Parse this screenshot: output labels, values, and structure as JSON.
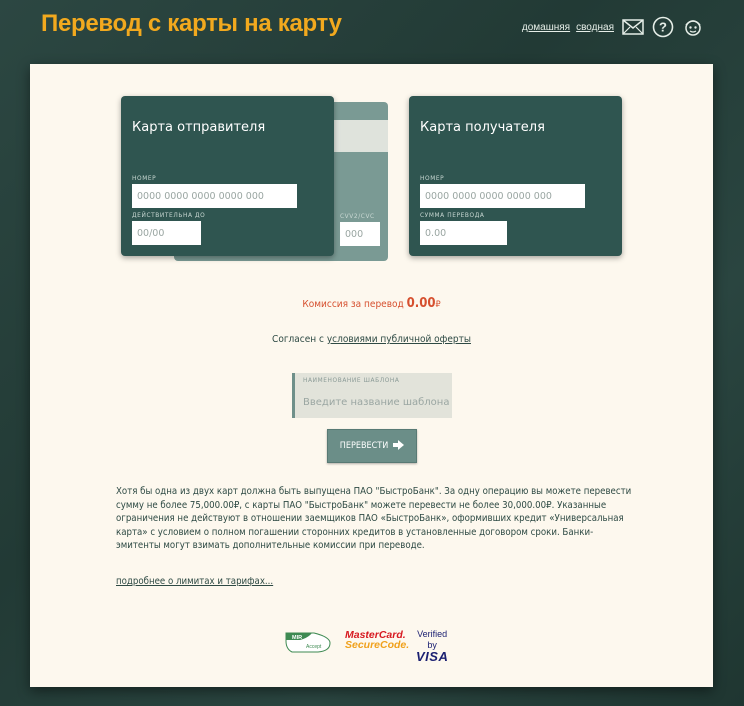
{
  "header": {
    "title": "Перевод с карты на карту",
    "nav": {
      "home": "домашняя",
      "summary": "сводная"
    },
    "icons": [
      "mail-icon",
      "help-icon",
      "profile-icon"
    ]
  },
  "sender_card": {
    "title": "Карта отправителя",
    "number_label": "НОМЕР",
    "number_placeholder": "0000 0000 0000 0000 000",
    "valid_label": "ДЕЙСТВИТЕЛЬНА ДО",
    "valid_placeholder": "00/00",
    "cvv_label": "CVV2/CVC",
    "cvv_placeholder": "000"
  },
  "recipient_card": {
    "title": "Карта получателя",
    "number_label": "НОМЕР",
    "number_placeholder": "0000 0000 0000 0000 000",
    "amount_label": "СУММА ПЕРЕВОДА",
    "amount_placeholder": "0.00"
  },
  "fee": {
    "label": "Комиссия за перевод",
    "value": "0.00",
    "currency": "₽"
  },
  "agreement": {
    "prefix": "Согласен с",
    "link": "условиями публичной оферты"
  },
  "template": {
    "label": "НАИМЕНОВАНИЕ ШАБЛОНА",
    "placeholder": "Введите название шаблона"
  },
  "submit": {
    "label": "ПЕРЕВЕСТИ"
  },
  "info_text": "Хотя бы одна из двух карт должна быть выпущена ПАО \"БыстроБанк\". За одну операцию вы можете перевести сумму не более 75,000.00₽, с карты ПАО \"БыстроБанк\" можете перевести не более 30,000.00₽. Указанные ограничения не действуют в отношении заемщиков ПАО «БыстроБанк», оформивших кредит «Универсальная карта» с условием о полном погашении сторонних кредитов в установленные договором сроки. Банки-эмитенты могут взимать дополнительные комиссии при переводе.",
  "more_link": "подробнее о лимитах и тарифах...",
  "logos": {
    "mir_top": "MIR",
    "mir_bottom": "Accept",
    "mastercard_line1": "MasterCard.",
    "mastercard_line2": "SecureCode.",
    "visa_line1": "Verified by",
    "visa_line2": "VISA"
  },
  "colors": {
    "accent": "#f2a91e",
    "card": "#2f5550",
    "fee": "#d6502f",
    "panel": "#fdf8ee"
  }
}
